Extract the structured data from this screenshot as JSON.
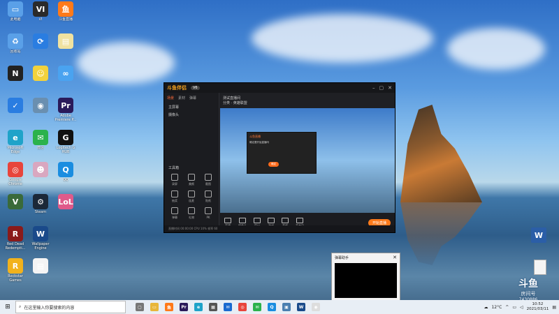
{
  "desktop": {
    "icons": [
      {
        "label": "此电脑",
        "icon": "computer-icon",
        "color": "#5aa0e8",
        "glyph": "▭"
      },
      {
        "label": "VI",
        "icon": "vi-app-icon",
        "color": "#2a2a2a",
        "glyph": "VI"
      },
      {
        "label": "斗鱼直播",
        "icon": "douyu-icon",
        "color": "#ff7a1a",
        "glyph": "鱼"
      },
      {
        "label": "回收站",
        "icon": "recycle-bin-icon",
        "color": "#5aa0e8",
        "glyph": "♻"
      },
      {
        "label": "",
        "icon": "app-icon",
        "color": "#2a7de1",
        "glyph": "⟳"
      },
      {
        "label": "",
        "icon": "file-icon",
        "color": "#f0e2a0",
        "glyph": "▤"
      },
      {
        "label": "",
        "icon": "notion-icon",
        "color": "#222",
        "glyph": "N"
      },
      {
        "label": "",
        "icon": "spongebob-icon",
        "color": "#f2d23c",
        "glyph": "☺"
      },
      {
        "label": "",
        "icon": "cloud-icon",
        "color": "#4aa3f0",
        "glyph": "∞"
      },
      {
        "label": "",
        "icon": "shield-icon",
        "color": "#2a7de1",
        "glyph": "✓"
      },
      {
        "label": "",
        "icon": "ball-icon",
        "color": "#6a8fb0",
        "glyph": "◉"
      },
      {
        "label": "Adobe Premiere P...",
        "icon": "premiere-icon",
        "color": "#2a1a5a",
        "glyph": "Pr"
      },
      {
        "label": "Microsoft Edge",
        "icon": "edge-icon",
        "color": "#1fa3c9",
        "glyph": "e"
      },
      {
        "label": "微信",
        "icon": "wechat-icon",
        "color": "#2bb24c",
        "glyph": "✉"
      },
      {
        "label": "Logitech G HUB",
        "icon": "logitech-icon",
        "color": "#111",
        "glyph": "G"
      },
      {
        "label": "Google Chrome",
        "icon": "chrome-icon",
        "color": "#e8453c",
        "glyph": "◎"
      },
      {
        "label": "",
        "icon": "anime-icon",
        "color": "#d9a7c0",
        "glyph": "☻"
      },
      {
        "label": "QQ",
        "icon": "qq-icon",
        "color": "#1a8de0",
        "glyph": "Q"
      },
      {
        "label": "",
        "icon": "gta-icon",
        "color": "#3a6a3a",
        "glyph": "V"
      },
      {
        "label": "Steam",
        "icon": "steam-icon",
        "color": "#1b2838",
        "glyph": "⚙"
      },
      {
        "label": "",
        "icon": "lol-icon",
        "color": "#e05a8a",
        "glyph": "LoL"
      },
      {
        "label": "Red Dead Redempti...",
        "icon": "rdr-icon",
        "color": "#8a1a1a",
        "glyph": "R"
      },
      {
        "label": "Wallpaper Engine",
        "icon": "wallpaper-engine-icon",
        "color": "#1a4a8a",
        "glyph": "W"
      },
      {
        "label": "",
        "icon": "blank-icon",
        "color": "transparent",
        "glyph": ""
      },
      {
        "label": "Rockstar Games",
        "icon": "rockstar-icon",
        "color": "#f2b21c",
        "glyph": "R"
      },
      {
        "label": "",
        "icon": "document-icon",
        "color": "#f4f4f4",
        "glyph": "▤"
      }
    ]
  },
  "app": {
    "logo": "斗鱼伴侣",
    "version": "V6",
    "sidebar_tabs": [
      "场景",
      "素材",
      "弹幕"
    ],
    "sidebar_rows": [
      "主屏幕",
      "摄像头"
    ],
    "tools_title": "工具箱",
    "tools": [
      "录屏",
      "美颜",
      "截图",
      "抽奖",
      "连麦",
      "贴纸",
      "弹幕",
      "礼物",
      "PK"
    ],
    "topbar_title": "测试直播间",
    "topbar_sub": "分类 · 英雄联盟",
    "bottom_items": [
      "直播",
      "摄像头",
      "窗口",
      "游戏",
      "音频",
      "麦克风"
    ],
    "live_button": "开始直播",
    "statusline": "直播时间 00:00:00   CPU 10%   帧率 60",
    "inner_dialog_title": "斗鱼直播",
    "inner_dialog_body": "确定要开始直播吗",
    "inner_dialog_button": "确定"
  },
  "mini_window": {
    "title": "弹幕助手",
    "close": "✕"
  },
  "right_desktop": {
    "word_label": "W",
    "douyu_logo": "斗鱼",
    "douyu_room": "房间号",
    "douyu_id": "7430886"
  },
  "taskbar": {
    "search_placeholder": "在这里输入你要搜索的内容",
    "apps": [
      {
        "icon": "task-view-icon",
        "color": "#777",
        "glyph": "▢"
      },
      {
        "icon": "file-explorer-icon",
        "color": "#e8b63a",
        "glyph": "▭"
      },
      {
        "icon": "douyu-task-icon",
        "color": "#ff7a1a",
        "glyph": "鱼"
      },
      {
        "icon": "premiere-task-icon",
        "color": "#2a1a5a",
        "glyph": "Pr"
      },
      {
        "icon": "edge-task-icon",
        "color": "#1fa3c9",
        "glyph": "e"
      },
      {
        "icon": "store-icon",
        "color": "#555",
        "glyph": "▦"
      },
      {
        "icon": "mail-icon",
        "color": "#1a6ad0",
        "glyph": "✉"
      },
      {
        "icon": "chrome-task-icon",
        "color": "#e8453c",
        "glyph": "◎"
      },
      {
        "icon": "wechat-task-icon",
        "color": "#2bb24c",
        "glyph": "✉"
      },
      {
        "icon": "qq-task-icon",
        "color": "#1a8de0",
        "glyph": "Q"
      },
      {
        "icon": "photo-icon",
        "color": "#4a7fb0",
        "glyph": "▣"
      },
      {
        "icon": "wallpaper-task-icon",
        "color": "#1a4a8a",
        "glyph": "W"
      },
      {
        "icon": "ball-task-icon",
        "color": "#ddd",
        "glyph": "◉"
      }
    ],
    "weather": "12°C",
    "time": "10:52",
    "date": "2021/03/11"
  }
}
